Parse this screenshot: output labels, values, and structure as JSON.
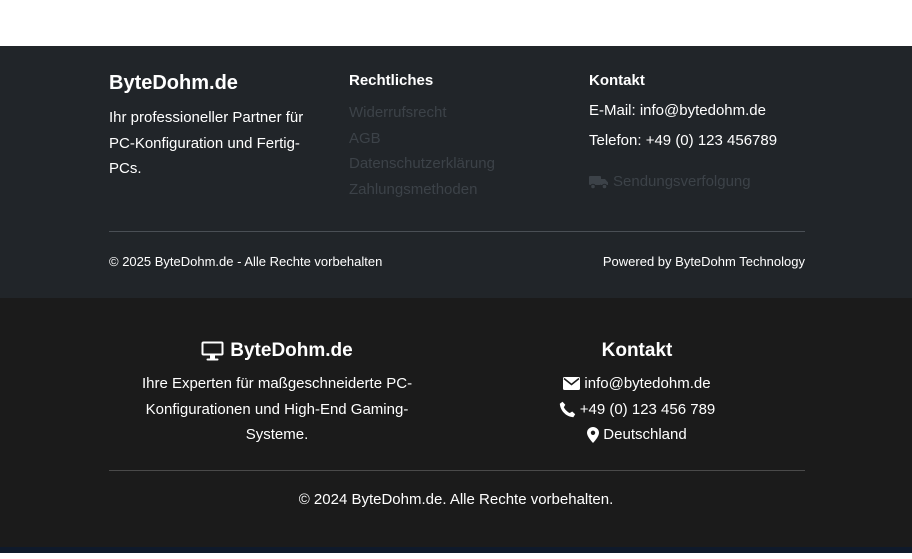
{
  "footer_top": {
    "brand": {
      "title": "ByteDohm.de",
      "description": "Ihr professioneller Partner für PC-Konfiguration und Fertig-PCs."
    },
    "legal": {
      "heading": "Rechtliches",
      "links": [
        "Widerrufsrecht",
        "AGB",
        "Datenschutzerklärung",
        "Zahlungsmethoden"
      ]
    },
    "contact": {
      "heading": "Kontakt",
      "email": "E-Mail: info@bytedohm.de",
      "phone": "Telefon: +49 (0) 123 456789",
      "tracking_label": "Sendungsverfolgung",
      "tracking_icon": "truck-icon"
    },
    "copyright": "© 2025 ByteDohm.de - Alle Rechte vorbehalten",
    "powered_by": "Powered by ByteDohm Technology"
  },
  "footer_bottom": {
    "brand": {
      "icon": "monitor-icon",
      "title": "ByteDohm.de",
      "description": "Ihre Experten für maßgeschneiderte PC-Konfigurationen und High-End Gaming-Systeme."
    },
    "contact": {
      "heading": "Kontakt",
      "email": "info@bytedohm.de",
      "phone": "+49 (0) 123 456 789",
      "location": "Deutschland"
    },
    "copyright": "© 2024 ByteDohm.de. Alle Rechte vorbehalten."
  },
  "colors": {
    "footer_top_bg": "#212529",
    "footer_bottom_bg": "#1b1b1b",
    "muted_link": "#3c4248",
    "text": "#ffffff"
  }
}
